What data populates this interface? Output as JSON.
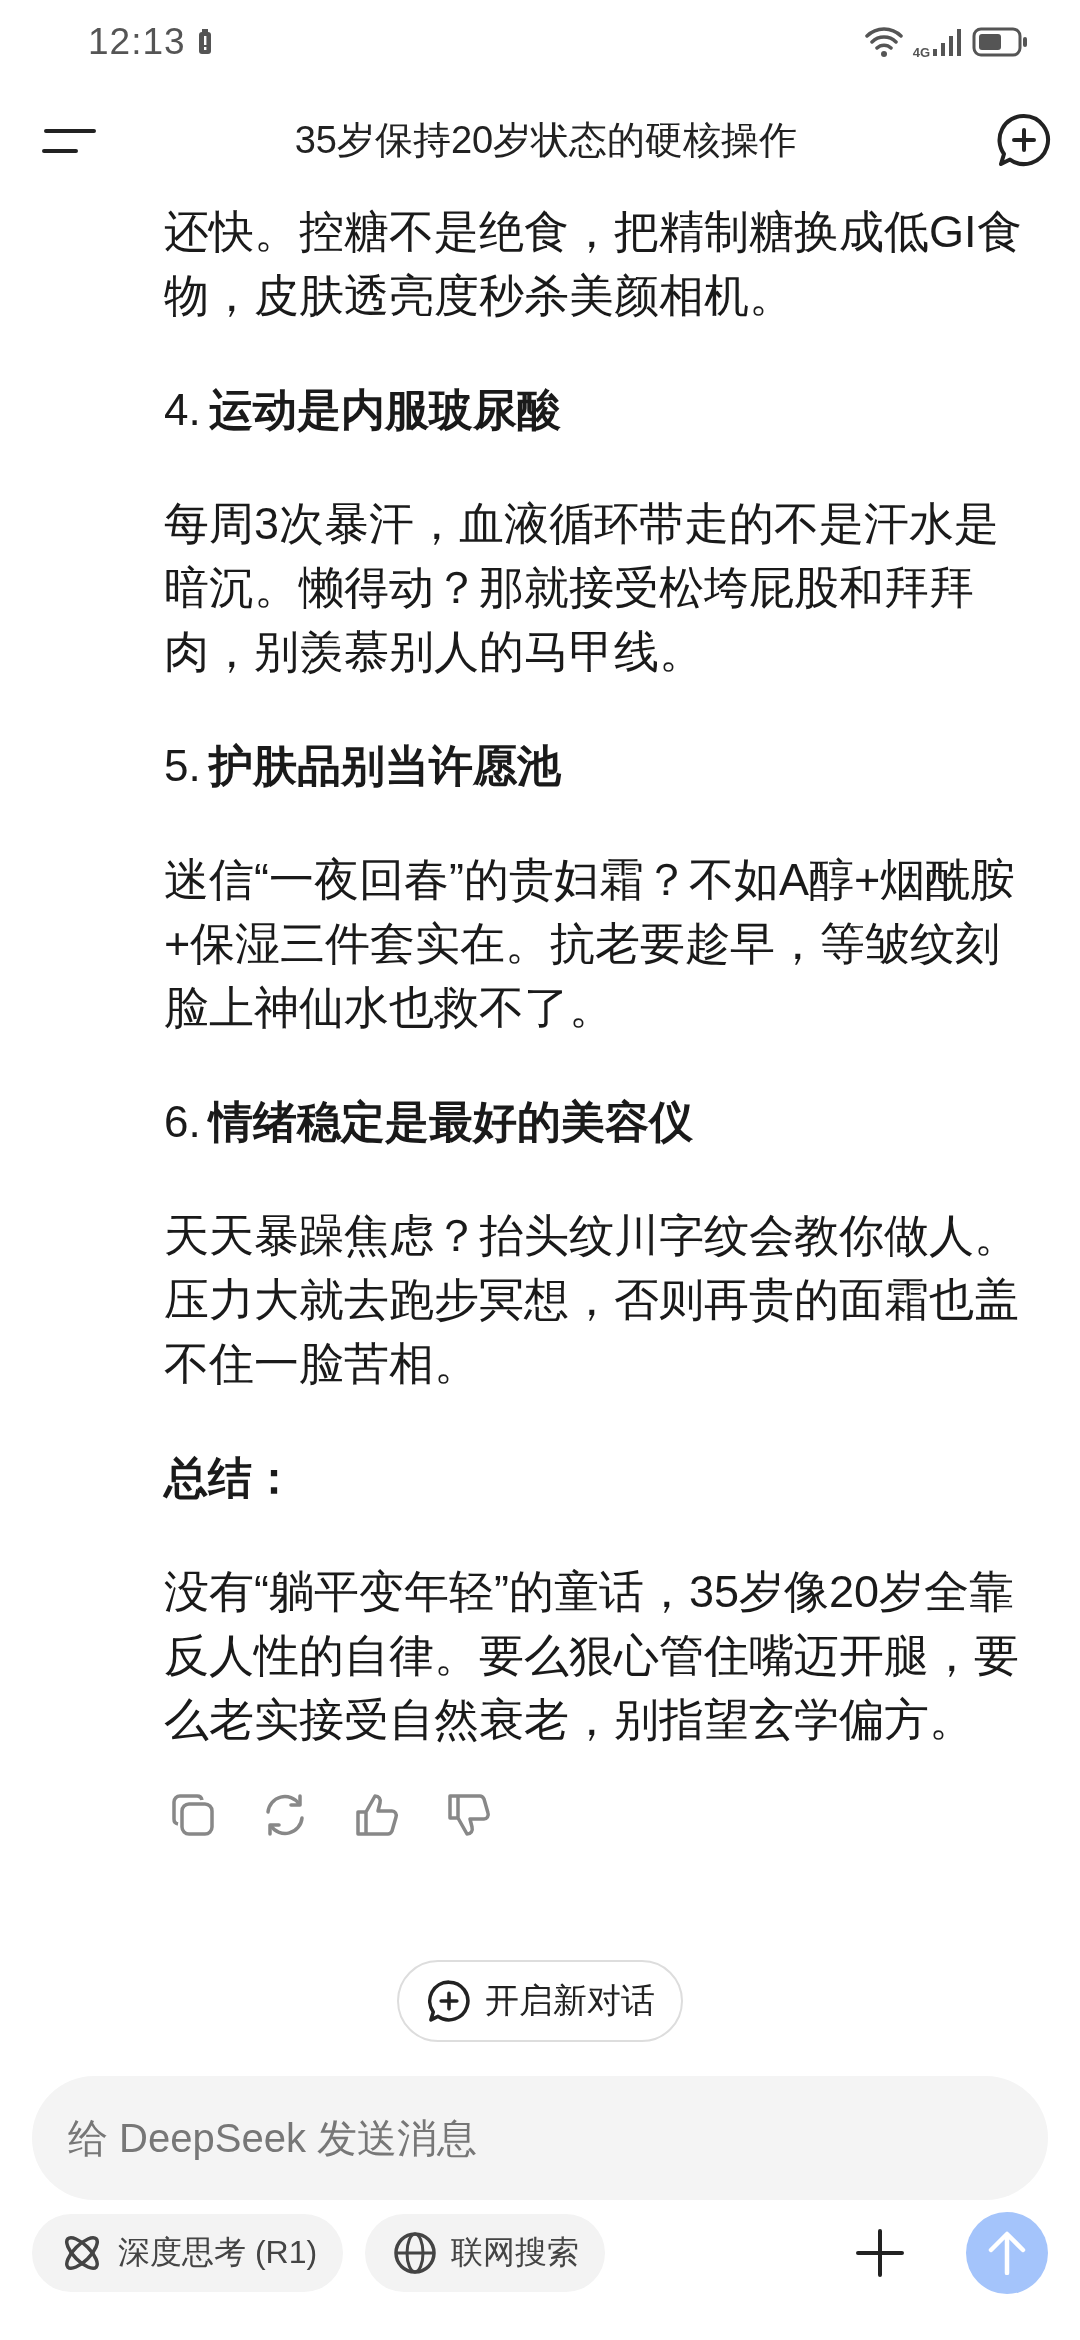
{
  "status_bar": {
    "time": "12:13",
    "network": "4G"
  },
  "header": {
    "title": "35岁保持20岁状态的硬核操作"
  },
  "message": {
    "blocks": [
      {
        "kind": "paragraph",
        "text": "还快。控糖不是绝食，把精制糖换成低GI食物，皮肤透亮度秒杀美颜相机。"
      },
      {
        "kind": "heading",
        "number": "4.",
        "text": "运动是内服玻尿酸"
      },
      {
        "kind": "paragraph",
        "text": "每周3次暴汗，血液循环带走的不是汗水是暗沉。懒得动？那就接受松垮屁股和拜拜肉，别羡慕别人的马甲线。"
      },
      {
        "kind": "heading",
        "number": "5.",
        "text": "护肤品别当许愿池"
      },
      {
        "kind": "paragraph",
        "text": "迷信“一夜回春”的贵妇霜？不如A醇+烟酰胺+保湿三件套实在。抗老要趁早，等皱纹刻脸上神仙水也救不了。"
      },
      {
        "kind": "heading",
        "number": "6.",
        "text": "情绪稳定是最好的美容仪"
      },
      {
        "kind": "paragraph",
        "text": "天天暴躁焦虑？抬头纹川字纹会教你做人。压力大就去跑步冥想，否则再贵的面霜也盖不住一脸苦相。"
      },
      {
        "kind": "heading",
        "text": "总结："
      },
      {
        "kind": "paragraph",
        "text": "没有“躺平变年轻”的童话，35岁像20岁全靠反人性的自律。要么狠心管住嘴迈开腿，要么老实接受自然衰老，别指望玄学偏方。"
      }
    ]
  },
  "new_chat_button": {
    "label": "开启新对话"
  },
  "composer": {
    "placeholder": "给 DeepSeek 发送消息",
    "toggles": [
      {
        "kind": "think",
        "label": "深度思考 (R1)",
        "selected": false
      },
      {
        "kind": "search",
        "label": "联网搜索",
        "selected": false
      }
    ],
    "send_disabled": true
  }
}
